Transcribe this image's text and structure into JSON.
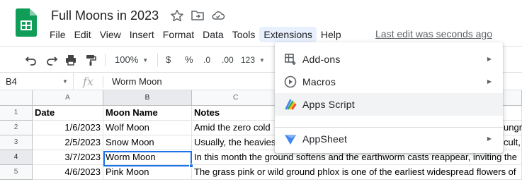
{
  "document": {
    "title": "Full Moons in 2023"
  },
  "menubar": {
    "items": [
      {
        "label": "File"
      },
      {
        "label": "Edit"
      },
      {
        "label": "View"
      },
      {
        "label": "Insert"
      },
      {
        "label": "Format"
      },
      {
        "label": "Data"
      },
      {
        "label": "Tools"
      },
      {
        "label": "Extensions",
        "active": true
      },
      {
        "label": "Help"
      }
    ],
    "last_edit": "Last edit was seconds ago"
  },
  "toolbar": {
    "zoom": "100%",
    "currency": "$",
    "percent": "%",
    "decrease_decimals": ".0",
    "increase_decimals": ".00",
    "more_formats": "123"
  },
  "formula_bar": {
    "cell_ref": "B4",
    "fx_label": "fx",
    "value": "Worm Moon"
  },
  "grid": {
    "columns": [
      "A",
      "B",
      "C"
    ],
    "selected_column": "B",
    "rows": [
      {
        "num": "1",
        "cells": [
          "Date",
          "Moon Name",
          "Notes"
        ]
      },
      {
        "num": "2",
        "cells": [
          "1/6/2023",
          "Wolf Moon",
          "Amid the zero cold"
        ]
      },
      {
        "num": "3",
        "cells": [
          "2/5/2023",
          "Snow Moon",
          "Usually, the heavies"
        ]
      },
      {
        "num": "4",
        "cells": [
          "3/7/2023",
          "Worm Moon",
          "In this month the ground softens and the earthworm casts reappear, inviting the"
        ]
      },
      {
        "num": "5",
        "cells": [
          "4/6/2023",
          "Pink Moon",
          "The grass pink or wild ground phlox is one of the earliest widespread flowers of"
        ]
      }
    ],
    "selected_row": "4",
    "partial_right": [
      "ungri",
      "cult, a"
    ]
  },
  "extensions_menu": {
    "items": [
      {
        "label": "Add-ons",
        "icon": "addons-icon",
        "submenu": true
      },
      {
        "label": "Macros",
        "icon": "macros-icon",
        "submenu": true
      },
      {
        "label": "Apps Script",
        "icon": "apps-script-icon",
        "submenu": false
      },
      {
        "label": "AppSheet",
        "icon": "appsheet-icon",
        "submenu": true
      }
    ]
  },
  "colors": {
    "accent": "#1a73e8",
    "sheets_green": "#0f9d58",
    "menu_active": "#e8f0fe"
  }
}
